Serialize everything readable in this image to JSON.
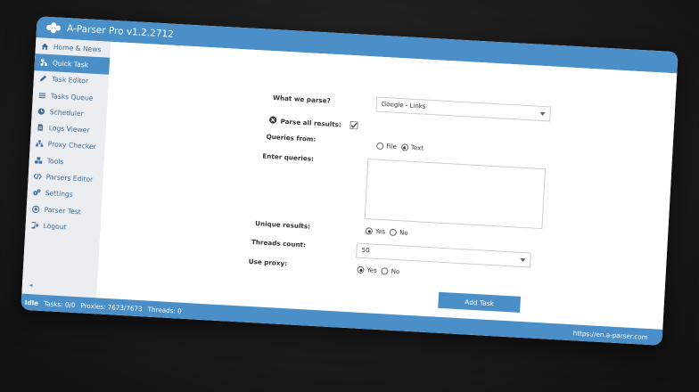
{
  "app": {
    "title": "A-Parser Pro v1.2.2712",
    "accent": "#4a8fc8"
  },
  "sidebar": {
    "items": [
      {
        "label": "Home & News",
        "icon": "home-icon"
      },
      {
        "label": "Quick Task",
        "icon": "sitemap-icon",
        "active": true
      },
      {
        "label": "Task Editor",
        "icon": "pencil-icon"
      },
      {
        "label": "Tasks Queue",
        "icon": "list-icon"
      },
      {
        "label": "Scheduler",
        "icon": "clock-icon"
      },
      {
        "label": "Logs Viewer",
        "icon": "file-icon"
      },
      {
        "label": "Proxy Checker",
        "icon": "network-icon"
      },
      {
        "label": "Tools",
        "icon": "cubes-icon"
      },
      {
        "label": "Parsers Editor",
        "icon": "code-icon"
      },
      {
        "label": "Settings",
        "icon": "gears-icon"
      },
      {
        "label": "Parser Test",
        "icon": "target-icon"
      },
      {
        "label": "Logout",
        "icon": "logout-icon"
      }
    ],
    "collapse_glyph": "◂"
  },
  "form": {
    "what_we_parse_label": "What we parse?",
    "parser_value": "Google - Links",
    "parse_all_label": "Parse all results:",
    "queries_from_label": "Queries from:",
    "queries_from_options": [
      "File",
      "Text"
    ],
    "enter_queries_label": "Enter queries:",
    "unique_results_label": "Unique results:",
    "unique_options": [
      "Yes",
      "No"
    ],
    "threads_label": "Threads count:",
    "threads_value": "50",
    "use_proxy_label": "Use proxy:",
    "proxy_options": [
      "Yes",
      "No"
    ],
    "add_task_label": "Add Task"
  },
  "status": {
    "state": "Idle",
    "tasks": "Tasks: 0/0",
    "proxies": "Proxies: 7673/7673",
    "threads": "Threads: 0",
    "link": "https://en.a-parser.com"
  }
}
